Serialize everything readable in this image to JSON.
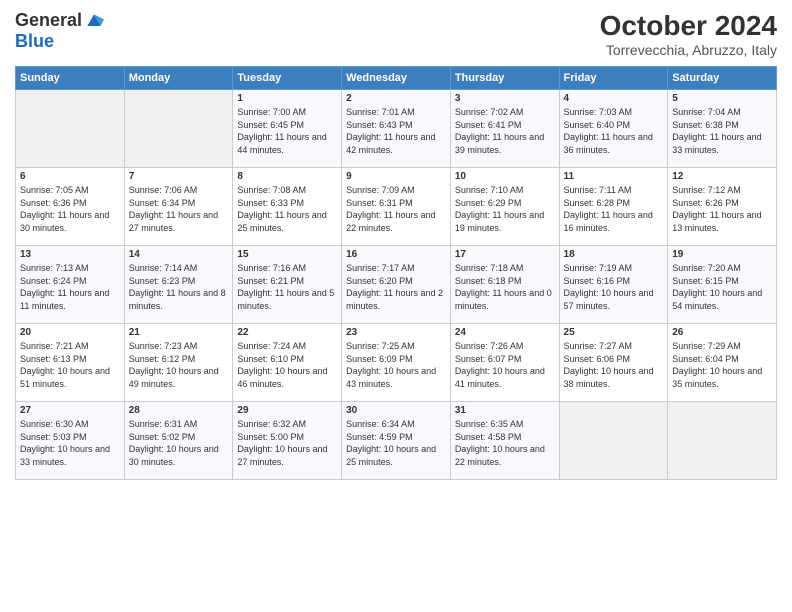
{
  "logo": {
    "general": "General",
    "blue": "Blue"
  },
  "title": "October 2024",
  "subtitle": "Torrevecchia, Abruzzo, Italy",
  "days_header": [
    "Sunday",
    "Monday",
    "Tuesday",
    "Wednesday",
    "Thursday",
    "Friday",
    "Saturday"
  ],
  "weeks": [
    [
      {
        "day": "",
        "info": ""
      },
      {
        "day": "",
        "info": ""
      },
      {
        "day": "1",
        "info": "Sunrise: 7:00 AM\nSunset: 6:45 PM\nDaylight: 11 hours and 44 minutes."
      },
      {
        "day": "2",
        "info": "Sunrise: 7:01 AM\nSunset: 6:43 PM\nDaylight: 11 hours and 42 minutes."
      },
      {
        "day": "3",
        "info": "Sunrise: 7:02 AM\nSunset: 6:41 PM\nDaylight: 11 hours and 39 minutes."
      },
      {
        "day": "4",
        "info": "Sunrise: 7:03 AM\nSunset: 6:40 PM\nDaylight: 11 hours and 36 minutes."
      },
      {
        "day": "5",
        "info": "Sunrise: 7:04 AM\nSunset: 6:38 PM\nDaylight: 11 hours and 33 minutes."
      }
    ],
    [
      {
        "day": "6",
        "info": "Sunrise: 7:05 AM\nSunset: 6:36 PM\nDaylight: 11 hours and 30 minutes."
      },
      {
        "day": "7",
        "info": "Sunrise: 7:06 AM\nSunset: 6:34 PM\nDaylight: 11 hours and 27 minutes."
      },
      {
        "day": "8",
        "info": "Sunrise: 7:08 AM\nSunset: 6:33 PM\nDaylight: 11 hours and 25 minutes."
      },
      {
        "day": "9",
        "info": "Sunrise: 7:09 AM\nSunset: 6:31 PM\nDaylight: 11 hours and 22 minutes."
      },
      {
        "day": "10",
        "info": "Sunrise: 7:10 AM\nSunset: 6:29 PM\nDaylight: 11 hours and 19 minutes."
      },
      {
        "day": "11",
        "info": "Sunrise: 7:11 AM\nSunset: 6:28 PM\nDaylight: 11 hours and 16 minutes."
      },
      {
        "day": "12",
        "info": "Sunrise: 7:12 AM\nSunset: 6:26 PM\nDaylight: 11 hours and 13 minutes."
      }
    ],
    [
      {
        "day": "13",
        "info": "Sunrise: 7:13 AM\nSunset: 6:24 PM\nDaylight: 11 hours and 11 minutes."
      },
      {
        "day": "14",
        "info": "Sunrise: 7:14 AM\nSunset: 6:23 PM\nDaylight: 11 hours and 8 minutes."
      },
      {
        "day": "15",
        "info": "Sunrise: 7:16 AM\nSunset: 6:21 PM\nDaylight: 11 hours and 5 minutes."
      },
      {
        "day": "16",
        "info": "Sunrise: 7:17 AM\nSunset: 6:20 PM\nDaylight: 11 hours and 2 minutes."
      },
      {
        "day": "17",
        "info": "Sunrise: 7:18 AM\nSunset: 6:18 PM\nDaylight: 11 hours and 0 minutes."
      },
      {
        "day": "18",
        "info": "Sunrise: 7:19 AM\nSunset: 6:16 PM\nDaylight: 10 hours and 57 minutes."
      },
      {
        "day": "19",
        "info": "Sunrise: 7:20 AM\nSunset: 6:15 PM\nDaylight: 10 hours and 54 minutes."
      }
    ],
    [
      {
        "day": "20",
        "info": "Sunrise: 7:21 AM\nSunset: 6:13 PM\nDaylight: 10 hours and 51 minutes."
      },
      {
        "day": "21",
        "info": "Sunrise: 7:23 AM\nSunset: 6:12 PM\nDaylight: 10 hours and 49 minutes."
      },
      {
        "day": "22",
        "info": "Sunrise: 7:24 AM\nSunset: 6:10 PM\nDaylight: 10 hours and 46 minutes."
      },
      {
        "day": "23",
        "info": "Sunrise: 7:25 AM\nSunset: 6:09 PM\nDaylight: 10 hours and 43 minutes."
      },
      {
        "day": "24",
        "info": "Sunrise: 7:26 AM\nSunset: 6:07 PM\nDaylight: 10 hours and 41 minutes."
      },
      {
        "day": "25",
        "info": "Sunrise: 7:27 AM\nSunset: 6:06 PM\nDaylight: 10 hours and 38 minutes."
      },
      {
        "day": "26",
        "info": "Sunrise: 7:29 AM\nSunset: 6:04 PM\nDaylight: 10 hours and 35 minutes."
      }
    ],
    [
      {
        "day": "27",
        "info": "Sunrise: 6:30 AM\nSunset: 5:03 PM\nDaylight: 10 hours and 33 minutes."
      },
      {
        "day": "28",
        "info": "Sunrise: 6:31 AM\nSunset: 5:02 PM\nDaylight: 10 hours and 30 minutes."
      },
      {
        "day": "29",
        "info": "Sunrise: 6:32 AM\nSunset: 5:00 PM\nDaylight: 10 hours and 27 minutes."
      },
      {
        "day": "30",
        "info": "Sunrise: 6:34 AM\nSunset: 4:59 PM\nDaylight: 10 hours and 25 minutes."
      },
      {
        "day": "31",
        "info": "Sunrise: 6:35 AM\nSunset: 4:58 PM\nDaylight: 10 hours and 22 minutes."
      },
      {
        "day": "",
        "info": ""
      },
      {
        "day": "",
        "info": ""
      }
    ]
  ]
}
